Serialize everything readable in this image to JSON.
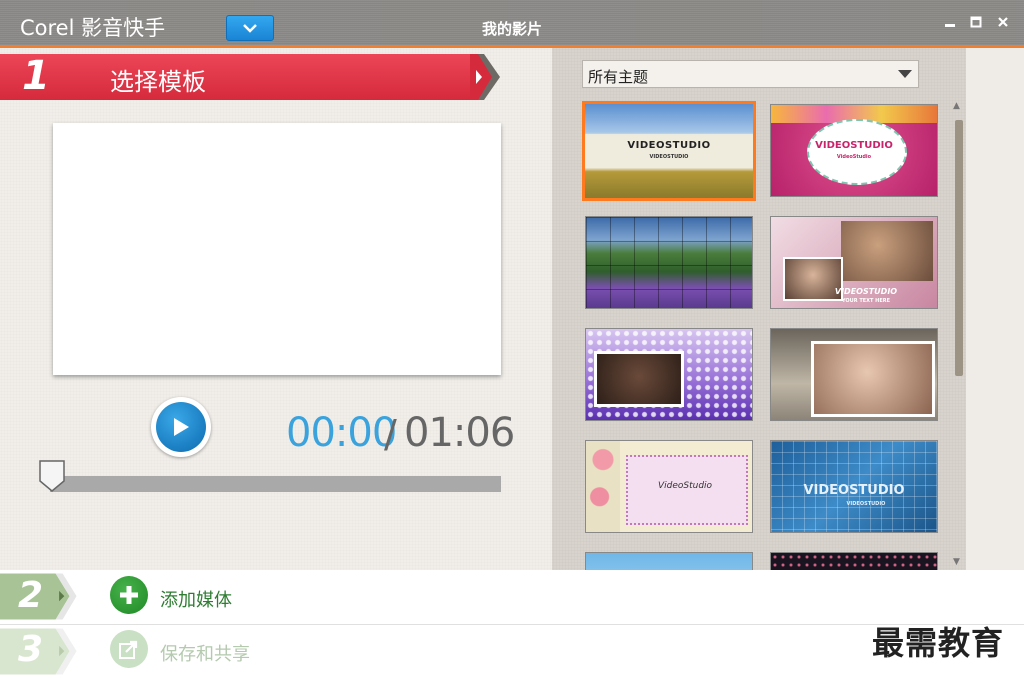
{
  "titlebar": {
    "app_title": "Corel 影音快手",
    "window_title": "我的影片"
  },
  "step1": {
    "number": "1",
    "label": "选择模板"
  },
  "player": {
    "current_time": "00:00",
    "separator": "/",
    "total_time": "01:06",
    "progress": 0
  },
  "themes": {
    "filter_selected": "所有主题",
    "items": [
      {
        "title": "VIDEOSTUDIO",
        "subtitle": "VIDEOSTUDIO",
        "selected": true
      },
      {
        "title": "VIDEOSTUDIO",
        "subtitle": "VideoStudio"
      },
      {
        "title": ""
      },
      {
        "title": "VIDEOSTUDIO",
        "subtitle": "YOUR TEXT HERE"
      },
      {
        "title": ""
      },
      {
        "title": ""
      },
      {
        "title": "VideoStudio"
      },
      {
        "title": "VIDEOSTUDIO",
        "subtitle": "VIDEOSTUDIO"
      }
    ]
  },
  "step2": {
    "number": "2",
    "label": "添加媒体"
  },
  "step3": {
    "number": "3",
    "label": "保存和共享"
  },
  "watermark": "最需教育",
  "colors": {
    "accent_orange": "#f08030",
    "step1_red": "#e03a4b",
    "step2_green": "#9fbf86",
    "play_blue": "#1a7cc4",
    "time_blue": "#3aa2dc"
  }
}
